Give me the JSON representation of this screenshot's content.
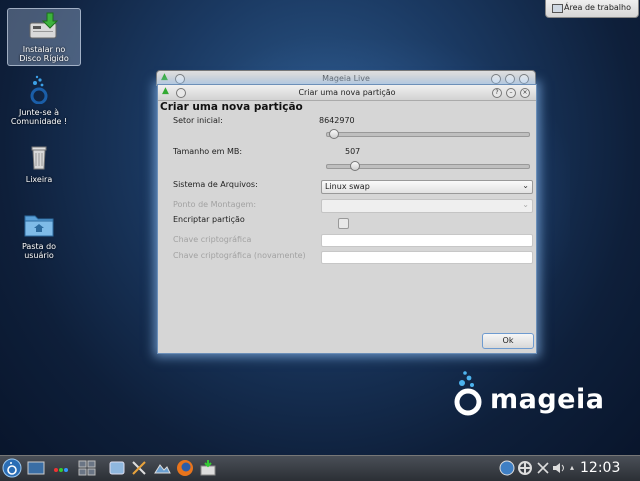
{
  "desktop": {
    "top_button_label": "Área de trabalho",
    "icons": [
      {
        "label_line1": "Instalar no",
        "label_line2": "Disco Rígido",
        "icon": "install-disk-icon"
      },
      {
        "label_line1": "Junte-se à",
        "label_line2": "Comunidade !",
        "icon": "community-icon"
      },
      {
        "label_line1": "Lixeira",
        "label_line2": "",
        "icon": "trash-icon"
      },
      {
        "label_line1": "Pasta do",
        "label_line2": "usuário",
        "icon": "home-folder-icon"
      }
    ]
  },
  "back_window": {
    "title": "Mageia Live"
  },
  "dialog": {
    "title": "Criar uma nova partição",
    "heading": "Criar uma nova partição",
    "setor_inicial": {
      "label": "Setor inicial:",
      "value": "8642970",
      "slider_fraction": 0.01
    },
    "tamanho": {
      "label": "Tamanho em MB:",
      "value": "507",
      "slider_fraction": 0.12
    },
    "sistema_arquivos": {
      "label": "Sistema de Arquivos:",
      "value": "Linux swap"
    },
    "ponto_montagem": {
      "label": "Ponto de Montagem:",
      "value": ""
    },
    "encriptar": {
      "label": "Encriptar partição",
      "checked": false
    },
    "chave": {
      "label": "Chave criptográfica",
      "value": ""
    },
    "chave_novamente": {
      "label": "Chave criptográfica (novamente)",
      "value": ""
    },
    "ok_label": "Ok"
  },
  "logo": {
    "text": "mageia"
  },
  "taskbar": {
    "clock": "12:03"
  },
  "colors": {
    "accent": "#6e9bd0",
    "desktop_bg": "#1b3a63"
  }
}
